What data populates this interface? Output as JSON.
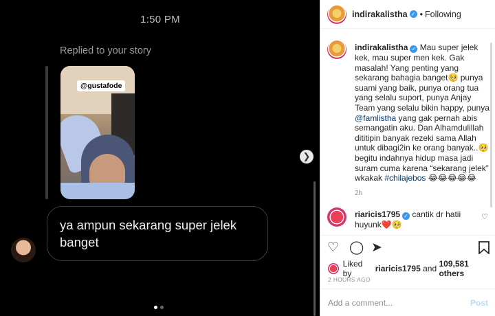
{
  "media": {
    "time": "1:50 PM",
    "replied_label": "Replied to your story",
    "story_tag": "@gustafode",
    "reply_message": "ya ampun sekarang super jelek banget",
    "next_icon": "chevron-right-icon"
  },
  "post": {
    "author": "indirakalistha",
    "separator": "•",
    "follow_label": "Following",
    "caption": {
      "username": "indirakalistha",
      "text_part1": "Mau super jelek kek, mau super men kek. Gak masalah! Yang penting yang sekarang bahagia banget🥺 punya suami yang baik, punya orang tua yang selalu suport, punya Anjay Team yang selalu bikin happy, punya",
      "mention": "@famlistha",
      "text_part2": "yang gak pernah abis semangatin aku. Dan Alhamdulillah dititipin banyak rezeki sama Allah untuk dibagi2in ke orang banyak..🥺 begitu indahnya hidup masa jadi suram cuma karena “sekarang jelek” wkakak",
      "hashtag": "#chilajebos",
      "emojis": "😂😂😂😂😂",
      "time": "2h"
    },
    "comment": {
      "username": "riaricis1795",
      "text": "cantik dr hatii huyunk❤️🥺"
    },
    "likes": {
      "prefix": "Liked by",
      "user": "riaricis1795",
      "and": "and",
      "count": "109,581 others"
    },
    "posted_ago": "2 HOURS AGO",
    "add_comment_placeholder": "Add a comment...",
    "post_label": "Post"
  },
  "icons": {
    "like": "heart-outline-icon",
    "comment": "speech-bubble-icon",
    "share": "paper-plane-icon",
    "save": "bookmark-icon"
  },
  "colors": {
    "verified": "#3897f0",
    "link": "#00376b",
    "post_disabled": "#b2dffc"
  }
}
